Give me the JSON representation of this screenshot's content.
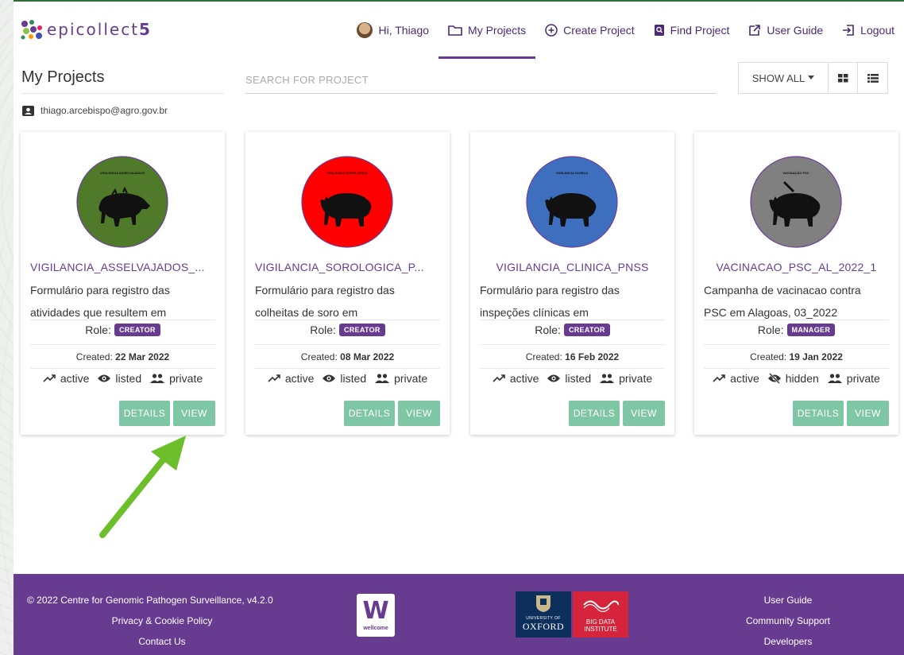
{
  "brand": {
    "name_letters": "epicollect",
    "name_number": "5"
  },
  "nav": {
    "greeting": "Hi, Thiago",
    "my_projects": "My Projects",
    "create_project": "Create Project",
    "find_project": "Find Project",
    "user_guide": "User Guide",
    "logout": "Logout"
  },
  "header": {
    "title": "My Projects",
    "search_placeholder": "SEARCH FOR PROJECT",
    "show_all": "SHOW ALL",
    "user_email": "thiago.arcebispo@agro.gov.br"
  },
  "projects": [
    {
      "title": "VIGILANCIA_ASSELVAJADOS_...",
      "logo_label": "VIGILÂNCIA ASSELVAJADOS",
      "logo_color": "#4e7a2a",
      "desc_line1": "Formulário para registro das",
      "desc_line2": "atividades que resultem em",
      "role_label": "Role:",
      "role": "CREATOR",
      "created_label": "Created:",
      "created": "22 Mar 2022",
      "status": "active",
      "visibility": "listed",
      "access": "private",
      "details": "DETAILS",
      "view": "VIEW"
    },
    {
      "title": "VIGILANCIA_SOROLOGICA_P...",
      "logo_label": "VIGILÂNCIA SOROLÓGICA",
      "logo_color": "#ff0000",
      "desc_line1": "Formulário para registro das",
      "desc_line2": "colheitas de soro em",
      "role_label": "Role:",
      "role": "CREATOR",
      "created_label": "Created:",
      "created": "08 Mar 2022",
      "status": "active",
      "visibility": "listed",
      "access": "private",
      "details": "DETAILS",
      "view": "VIEW"
    },
    {
      "title": "VIGILANCIA_CLINICA_PNSS",
      "logo_label": "VIGILÂNCIA CLÍNICA",
      "logo_color": "#3e6fbf",
      "desc_line1": "Formulário para registro das",
      "desc_line2": "inspeções clínicas em",
      "role_label": "Role:",
      "role": "CREATOR",
      "created_label": "Created:",
      "created": "16 Feb 2022",
      "status": "active",
      "visibility": "listed",
      "access": "private",
      "details": "DETAILS",
      "view": "VIEW"
    },
    {
      "title": "VACINACAO_PSC_AL_2022_1",
      "logo_label": "VACINAÇÃO PSC",
      "logo_color": "#808080",
      "desc_line1": "Campanha de vacinacao contra",
      "desc_line2": "PSC em Alagoas, 03_2022",
      "role_label": "Role:",
      "role": "MANAGER",
      "created_label": "Created:",
      "created": "19 Jan 2022",
      "status": "active",
      "visibility": "hidden",
      "access": "private",
      "details": "DETAILS",
      "view": "VIEW"
    }
  ],
  "footer": {
    "copyright": "© 2022 Centre for Genomic Pathogen Surveillance, v4.2.0",
    "privacy": "Privacy & Cookie Policy",
    "contact": "Contact Us",
    "wellcome_text": "wellcome",
    "oxford_small": "UNIVERSITY OF",
    "oxford_big": "OXFORD",
    "bigdata": "BIG DATA INSTITUTE",
    "user_guide": "User Guide",
    "community": "Community Support",
    "developers": "Developers"
  },
  "colors": {
    "brand_purple": "#673c90",
    "button_green": "#7fc6a4",
    "arrow_green": "#6cbf2b"
  }
}
